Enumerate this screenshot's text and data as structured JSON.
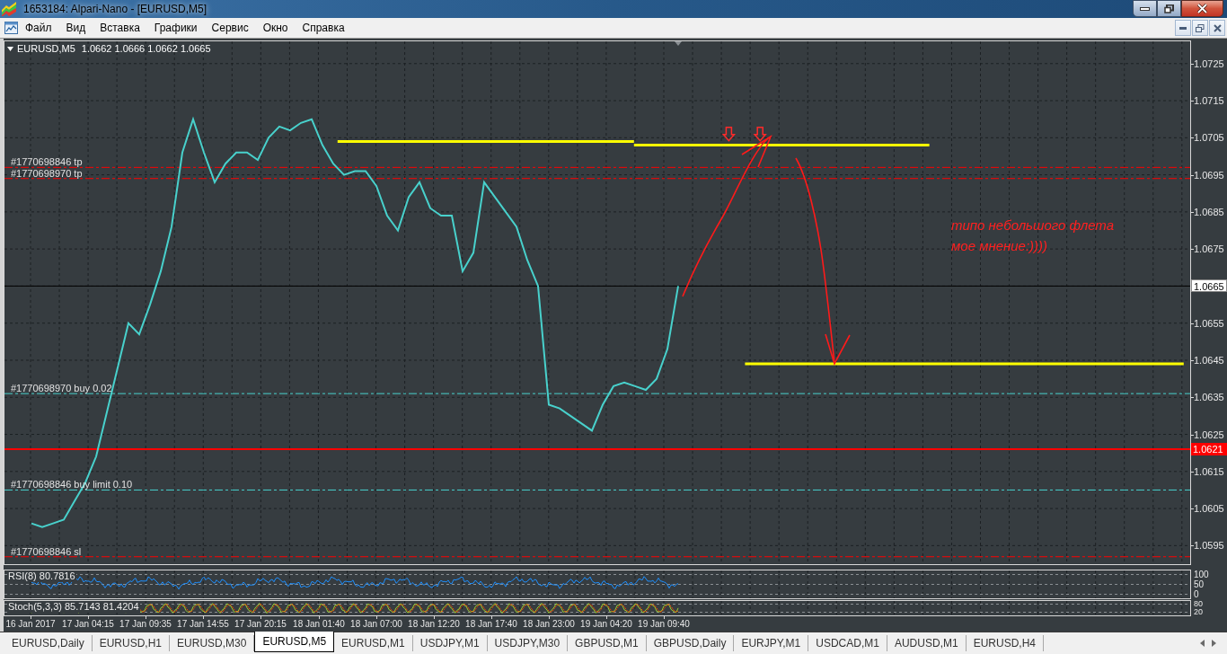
{
  "window": {
    "title": "1653184: Alpari-Nano - [EURUSD,M5]"
  },
  "menu": [
    "Файл",
    "Вид",
    "Вставка",
    "Графики",
    "Сервис",
    "Окно",
    "Справка"
  ],
  "chart": {
    "header": {
      "symbol": "EURUSD,M5",
      "ohlc": [
        "1.0662",
        "1.0666",
        "1.0662",
        "1.0665"
      ]
    },
    "chart_data": [
      {
        "type": "line",
        "xlim": [
          "2017-01-16T20:30",
          "2017-01-21T10:30"
        ],
        "ylim": [
          1.059,
          1.0731
        ],
        "series": [
          {
            "type": "line",
            "color": "#48d1cc",
            "x": [
              "2017-01-16T23:00",
              "2017-01-17T00:00",
              "2017-01-17T01:00",
              "2017-01-17T02:00",
              "2017-01-17T03:00",
              "2017-01-17T04:00",
              "2017-01-17T05:00",
              "2017-01-17T06:00",
              "2017-01-17T07:00",
              "2017-01-17T08:00",
              "2017-01-17T09:00",
              "2017-01-17T10:00",
              "2017-01-17T11:00",
              "2017-01-17T12:00",
              "2017-01-17T13:00",
              "2017-01-17T14:00",
              "2017-01-17T15:00",
              "2017-01-17T16:00",
              "2017-01-17T17:00",
              "2017-01-17T18:00",
              "2017-01-17T19:00",
              "2017-01-17T20:00",
              "2017-01-17T21:00",
              "2017-01-17T22:00",
              "2017-01-17T23:00",
              "2017-01-18T00:00",
              "2017-01-18T01:00",
              "2017-01-18T02:00",
              "2017-01-18T03:00",
              "2017-01-18T04:00",
              "2017-01-18T05:00",
              "2017-01-18T06:00",
              "2017-01-18T07:00",
              "2017-01-18T08:00",
              "2017-01-18T09:00",
              "2017-01-18T10:00",
              "2017-01-18T11:00",
              "2017-01-18T12:00",
              "2017-01-18T13:00",
              "2017-01-18T14:00",
              "2017-01-18T15:00",
              "2017-01-18T16:00",
              "2017-01-18T17:00",
              "2017-01-18T18:00",
              "2017-01-18T19:00",
              "2017-01-18T20:00",
              "2017-01-18T21:00",
              "2017-01-18T22:00",
              "2017-01-18T23:00",
              "2017-01-19T00:00",
              "2017-01-19T01:00",
              "2017-01-19T02:00",
              "2017-01-19T03:00",
              "2017-01-19T04:00",
              "2017-01-19T05:00",
              "2017-01-19T06:00",
              "2017-01-19T07:00",
              "2017-01-19T08:00",
              "2017-01-19T09:00",
              "2017-01-19T10:00",
              "2017-01-19T11:00"
            ],
            "values": [
              1.0601,
              1.06,
              1.0601,
              1.0602,
              1.0607,
              1.0612,
              1.0619,
              1.0631,
              1.0643,
              1.0655,
              1.0652,
              1.066,
              1.0669,
              1.0681,
              1.0701,
              1.071,
              1.0701,
              1.0693,
              1.0698,
              1.0701,
              1.0701,
              1.0699,
              1.0705,
              1.0708,
              1.0707,
              1.0709,
              1.071,
              1.0703,
              1.0698,
              1.0695,
              1.0696,
              1.0696,
              1.0692,
              1.0684,
              1.068,
              1.0689,
              1.0693,
              1.0686,
              1.0684,
              1.0684,
              1.0669,
              1.0674,
              1.0693,
              1.0689,
              1.0685,
              1.0681,
              1.0672,
              1.0665,
              1.0633,
              1.0632,
              1.063,
              1.0628,
              1.0626,
              1.0633,
              1.0638,
              1.0639,
              1.0638,
              1.0637,
              1.064,
              1.0648,
              1.0665
            ]
          },
          {
            "type": "line",
            "color": "#ffff00",
            "x": [
              "2017-01-18T03:24",
              "2017-01-19T06:54"
            ],
            "values": [
              1.0704,
              1.0704
            ]
          },
          {
            "type": "line",
            "color": "#ffff00",
            "x": [
              "2017-01-19T06:54",
              "2017-01-20T10:18"
            ],
            "values": [
              1.0703,
              1.0703
            ]
          },
          {
            "type": "line",
            "color": "#ffff00",
            "x": [
              "2017-01-19T17:12",
              "2017-01-21T09:54"
            ],
            "values": [
              1.0644,
              1.0644
            ]
          },
          {
            "type": "scatter",
            "color": "#ff2a2a",
            "x": [
              "2017-01-19T15:42",
              "2017-01-19T18:36"
            ],
            "values": [
              1.0706,
              1.0706
            ]
          }
        ],
        "xticks": [
          {
            "value": "2017-01-16T22:55",
            "label": "16 Jan 2017"
          },
          {
            "value": "2017-01-17T04:15",
            "label": "17 Jan 04:15"
          },
          {
            "value": "2017-01-17T09:35",
            "label": "17 Jan 09:35"
          },
          {
            "value": "2017-01-17T14:55",
            "label": "17 Jan 14:55"
          },
          {
            "value": "2017-01-17T20:15",
            "label": "17 Jan 20:15"
          },
          {
            "value": "2017-01-18T01:40",
            "label": "18 Jan 01:40"
          },
          {
            "value": "2017-01-18T07:00",
            "label": "18 Jan 07:00"
          },
          {
            "value": "2017-01-18T12:20",
            "label": "18 Jan 12:20"
          },
          {
            "value": "2017-01-18T17:40",
            "label": "18 Jan 17:40"
          },
          {
            "value": "2017-01-18T23:00",
            "label": "18 Jan 23:00"
          },
          {
            "value": "2017-01-19T04:20",
            "label": "19 Jan 04:20"
          },
          {
            "value": "2017-01-19T09:40",
            "label": "19 Jan 09:40"
          }
        ],
        "yticks": [
          1.0595,
          1.0605,
          1.0615,
          1.0625,
          1.0635,
          1.0645,
          1.0655,
          1.0665,
          1.0675,
          1.0685,
          1.0695,
          1.0705,
          1.0715,
          1.0725
        ],
        "grid": true,
        "ref_lines": [
          {
            "axis": "y",
            "value": 1.0697,
            "label": "#1770698846 tp",
            "color": "#ff0000",
            "line_style": "dashdot"
          },
          {
            "axis": "y",
            "value": 1.0694,
            "label": "#1770698970 tp",
            "color": "#ff0000",
            "line_style": "dashdot"
          },
          {
            "axis": "y",
            "value": 1.0665,
            "label": "1.0665",
            "color": "#000000",
            "line_style": "solid"
          },
          {
            "axis": "y",
            "value": 1.0636,
            "label": "#1770698970 buy 0.02",
            "color": "#48d1cc",
            "line_style": "dashdot"
          },
          {
            "axis": "y",
            "value": 1.0621,
            "label": "1.0621",
            "color": "#ff0000",
            "line_style": "solid"
          },
          {
            "axis": "y",
            "value": 1.061,
            "label": "#1770698846 buy limit 0.10",
            "color": "#48d1cc",
            "line_style": "dashdot"
          },
          {
            "axis": "y",
            "value": 1.0592,
            "label": "#1770698846 sl",
            "color": "#ff0000",
            "line_style": "dashdot"
          }
        ],
        "annotations": [
          "типо небольшого флета",
          "мое мнение:))))"
        ]
      }
    ],
    "indicators": [
      {
        "kind": "rsi",
        "label": "RSI(8) 80.7816",
        "axis_labels": [
          "100",
          "50",
          "0"
        ]
      },
      {
        "kind": "stochastic",
        "label": "Stoch(5,3,3) 85.7143 81.4204",
        "axis_labels": [
          "80",
          "20"
        ]
      }
    ]
  },
  "tabs": [
    {
      "label": "EURUSD,Daily",
      "selected": false
    },
    {
      "label": "EURUSD,H1",
      "selected": false
    },
    {
      "label": "EURUSD,M30",
      "selected": false
    },
    {
      "label": "EURUSD,M5",
      "selected": true
    },
    {
      "label": "EURUSD,M1",
      "selected": false
    },
    {
      "label": "USDJPY,M1",
      "selected": false
    },
    {
      "label": "USDJPY,M30",
      "selected": false
    },
    {
      "label": "GBPUSD,M1",
      "selected": false
    },
    {
      "label": "GBPUSD,Daily",
      "selected": false
    },
    {
      "label": "EURJPY,M1",
      "selected": false
    },
    {
      "label": "USDCAD,M1",
      "selected": false
    },
    {
      "label": "AUDUSD,M1",
      "selected": false
    },
    {
      "label": "EURUSD,H4",
      "selected": false
    }
  ]
}
